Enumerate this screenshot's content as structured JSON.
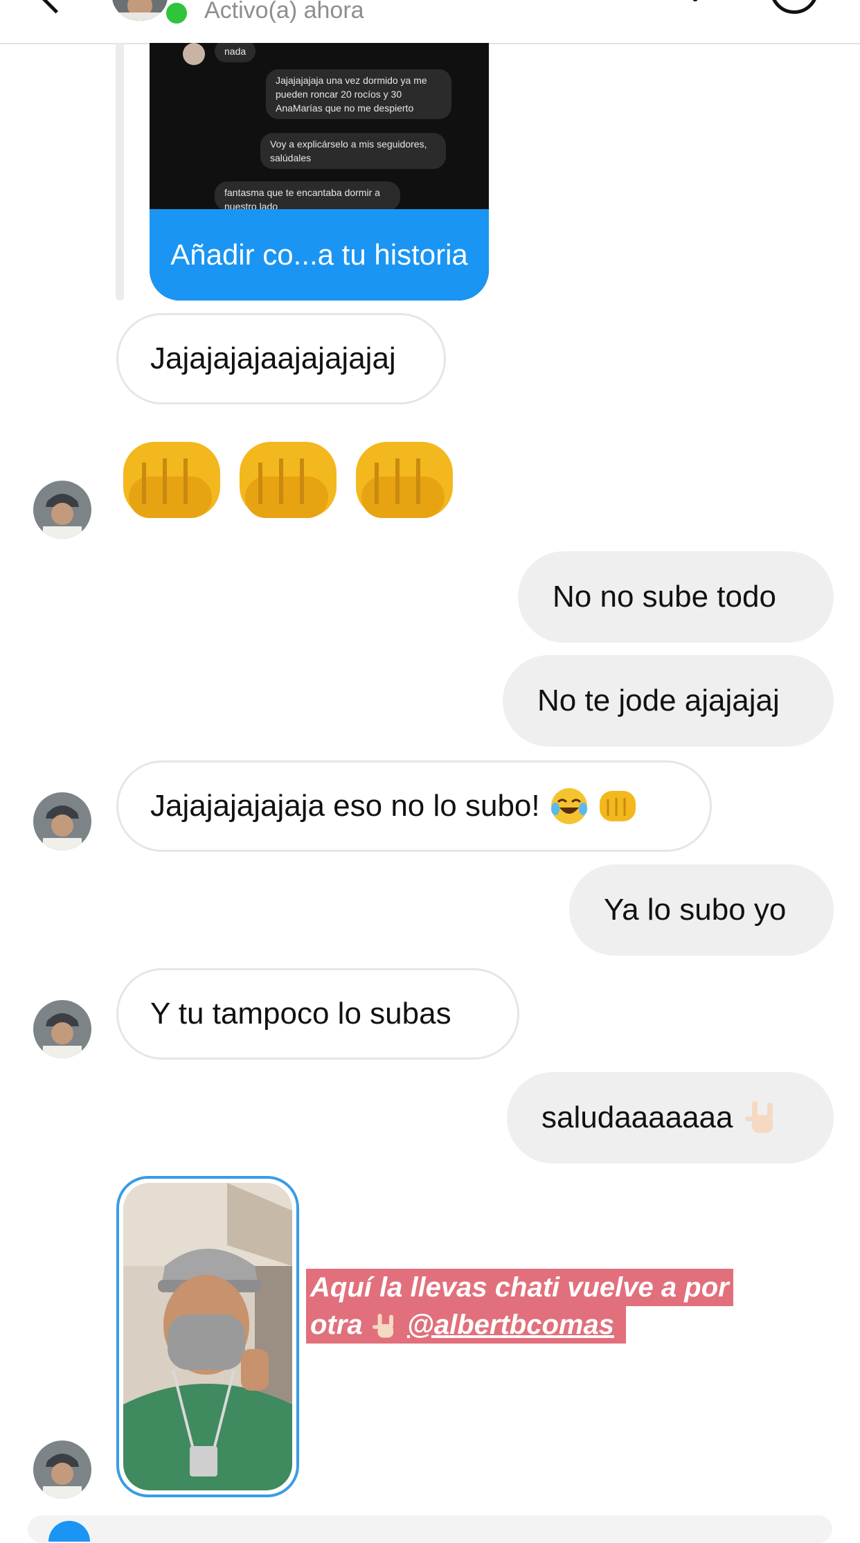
{
  "header": {
    "status": "Activo(a) ahora"
  },
  "shared_story": {
    "cta_label": "Añadir co...a tu historia",
    "preview_messages": [
      "nada",
      "Jajajajajaja una vez dormido ya me pueden roncar 20 rocíos y 30 AnaMarías que no me despierto",
      "Voy a explicárselo a mis seguidores, salúdales",
      "fantasma que te encantaba dormir a nuestro lado"
    ]
  },
  "messages": [
    {
      "from": "contact",
      "text": "Jajajajajaajajajajaj"
    },
    {
      "from": "contact",
      "emoji": "three oncoming fist emojis"
    },
    {
      "from": "me",
      "text": "No no sube todo"
    },
    {
      "from": "me",
      "text": "No te jode ajajajaj"
    },
    {
      "from": "contact",
      "text": "Jajajajajajaja eso no lo subo!"
    },
    {
      "from": "me",
      "text": "Ya lo subo yo"
    },
    {
      "from": "contact",
      "text": "Y tu tampoco lo subas"
    },
    {
      "from": "me",
      "text": "saludaaaaaaa"
    }
  ],
  "story_mention": {
    "caption_line1": "Aquí la llevas chati vuelve a por",
    "caption_line2_prefix": "otra",
    "mention": "@albertbcomas"
  },
  "colors": {
    "accent_blue": "#1a95f3",
    "online_green": "#2fc43b",
    "outgoing_bubble": "#efefef",
    "caption_highlight": "#e1707c"
  }
}
